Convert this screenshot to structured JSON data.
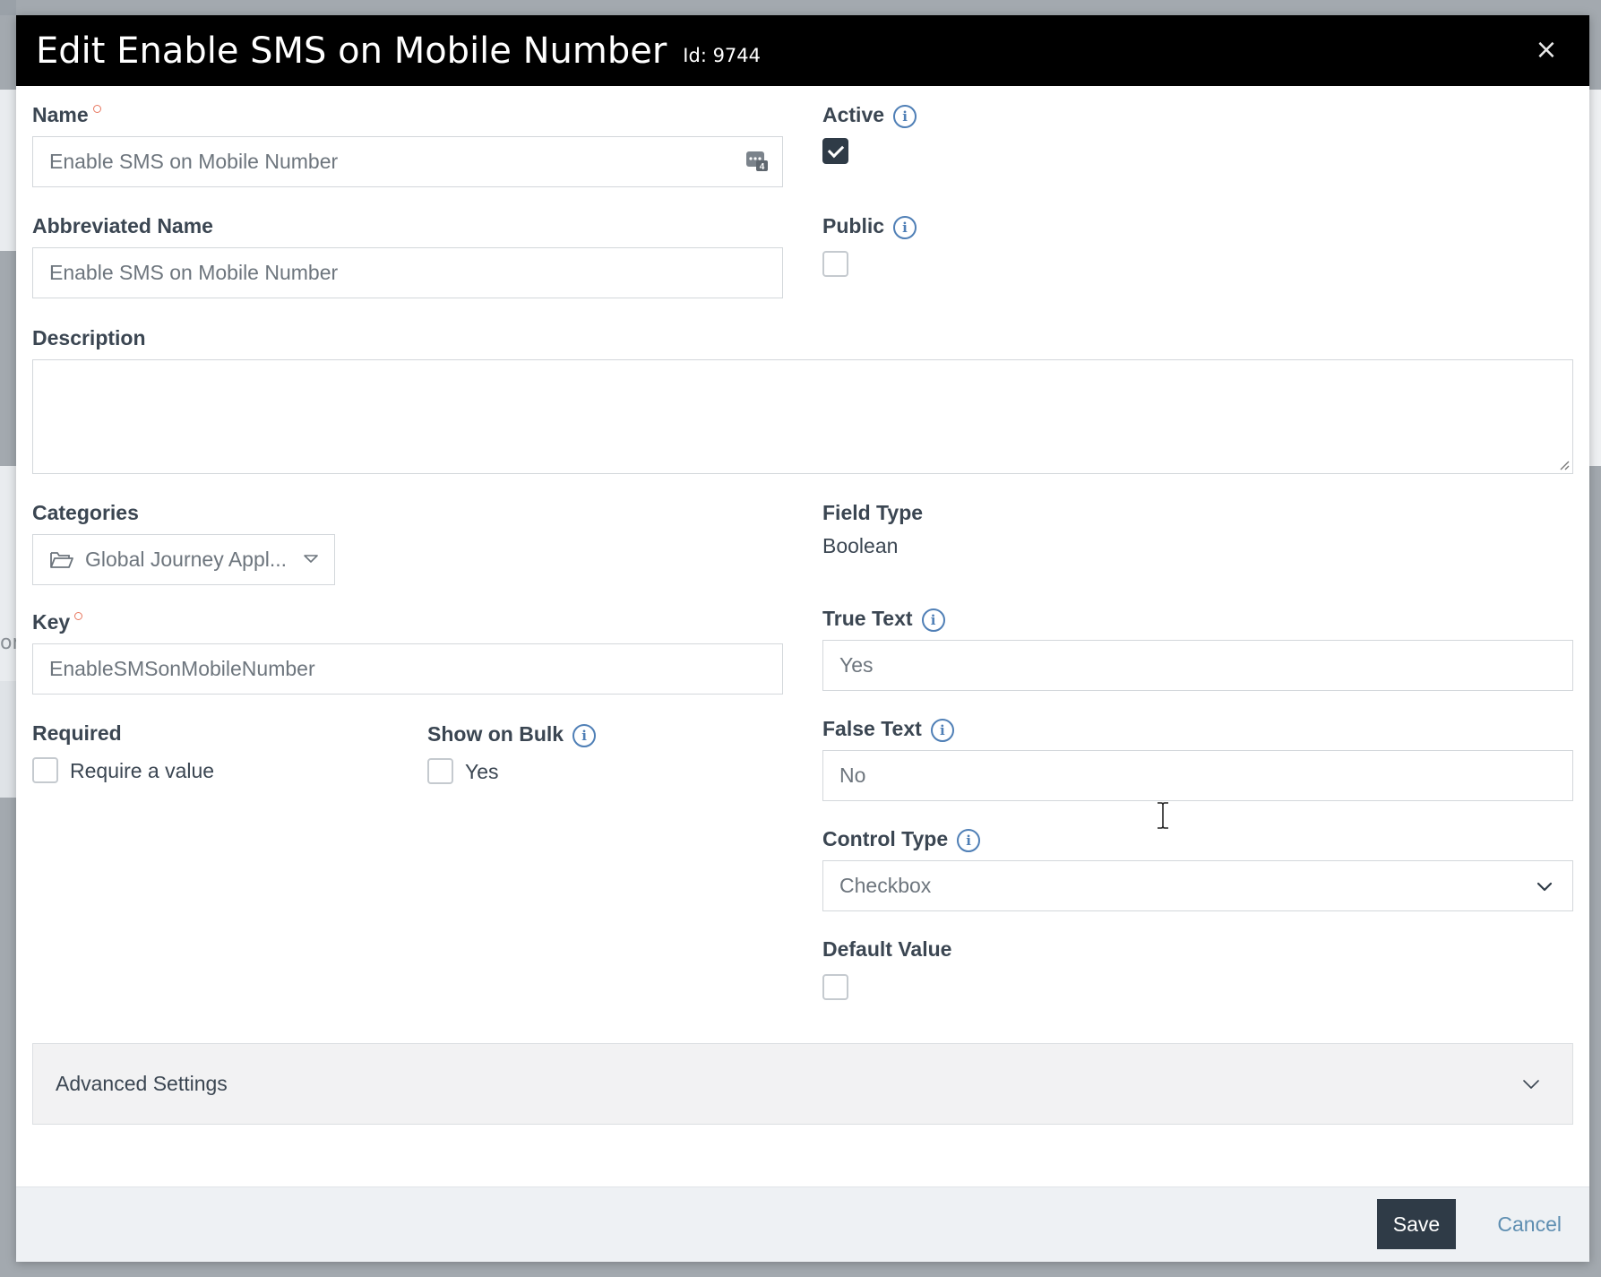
{
  "header": {
    "title": "Edit Enable SMS on Mobile Number",
    "id_label": "Id: 9744",
    "close_glyph": "×"
  },
  "background": {
    "partial_text": "on"
  },
  "form": {
    "name": {
      "label": "Name",
      "value": "Enable SMS on Mobile Number"
    },
    "active": {
      "label": "Active",
      "checked": true
    },
    "abbreviated_name": {
      "label": "Abbreviated Name",
      "value": "Enable SMS on Mobile Number"
    },
    "public": {
      "label": "Public",
      "checked": false
    },
    "description": {
      "label": "Description",
      "value": ""
    },
    "categories": {
      "label": "Categories",
      "value": "Global Journey Appl..."
    },
    "field_type": {
      "label": "Field Type",
      "value": "Boolean"
    },
    "key": {
      "label": "Key",
      "value": "EnableSMSonMobileNumber"
    },
    "true_text": {
      "label": "True Text",
      "value": "Yes"
    },
    "required": {
      "label": "Required",
      "option_label": "Require a value",
      "checked": false
    },
    "show_on_bulk": {
      "label": "Show on Bulk",
      "option_label": "Yes",
      "checked": false
    },
    "false_text": {
      "label": "False Text",
      "value": "No"
    },
    "control_type": {
      "label": "Control Type",
      "value": "Checkbox"
    },
    "default_value": {
      "label": "Default Value",
      "checked": false
    },
    "info_glyph": "i"
  },
  "advanced": {
    "label": "Advanced Settings"
  },
  "footer": {
    "save_label": "Save",
    "cancel_label": "Cancel"
  },
  "colors": {
    "header_bg": "#000000",
    "primary_button": "#2f3b47",
    "link": "#5e8eb1",
    "info_icon": "#4f7fb6",
    "required_dot": "#e8775f"
  }
}
